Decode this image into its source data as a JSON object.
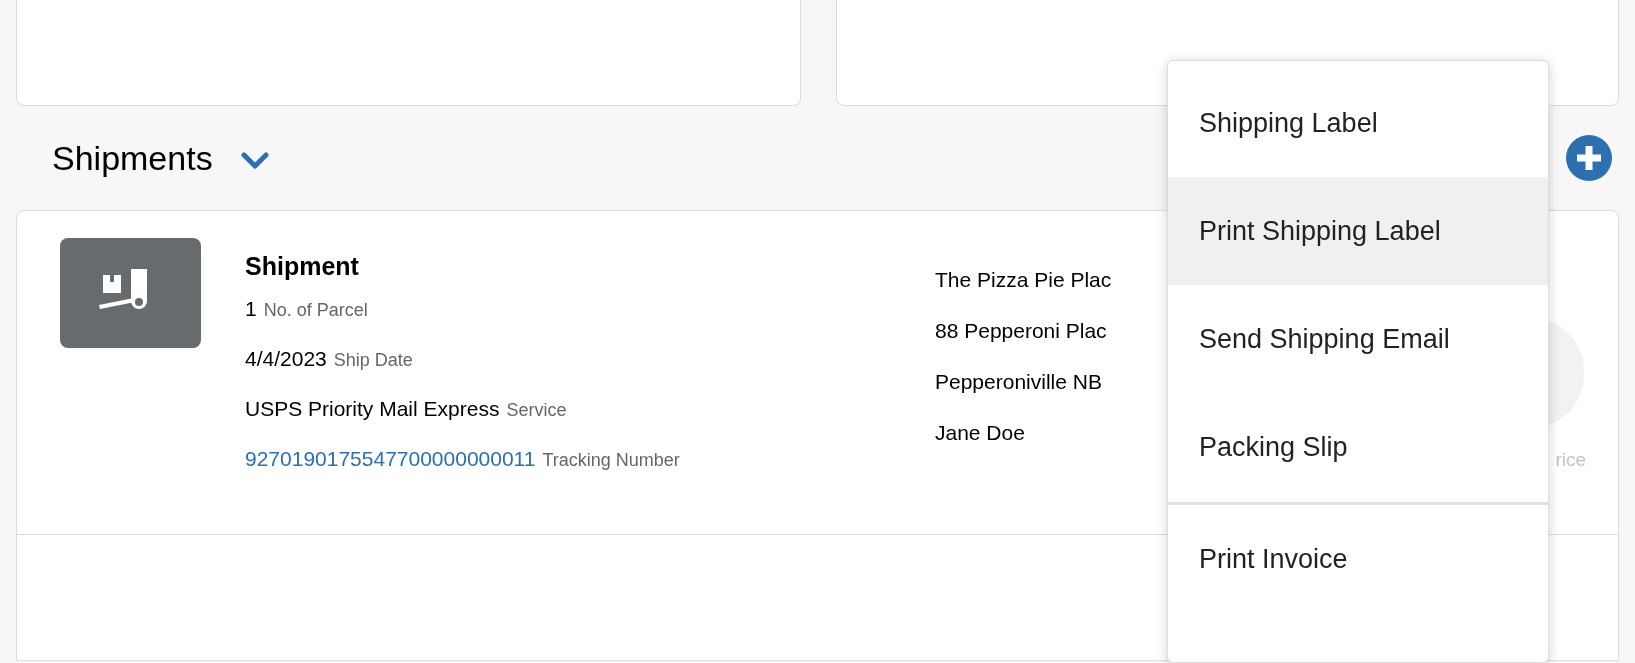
{
  "section": {
    "title": "Shipments"
  },
  "shipment": {
    "title": "Shipment",
    "fields": [
      {
        "value": "1",
        "label": "No. of Parcel",
        "kind": "text"
      },
      {
        "value": "4/4/2023",
        "label": "Ship Date",
        "kind": "text"
      },
      {
        "value": "USPS Priority Mail Express",
        "label": "Service",
        "kind": "text"
      },
      {
        "value": "9270190175547700000000011",
        "label": "Tracking Number",
        "kind": "link"
      }
    ],
    "address": [
      "The Pizza Pie Plac",
      "88 Pepperoni Plac",
      "Pepperoniville NB",
      "Jane Doe"
    ],
    "hidden_label": "rice"
  },
  "menu": {
    "items": [
      {
        "label": "Shipping Label",
        "selected": false,
        "divider_before": false
      },
      {
        "label": "Print Shipping Label",
        "selected": true,
        "divider_before": false
      },
      {
        "label": "Send Shipping Email",
        "selected": false,
        "divider_before": false
      },
      {
        "label": "Packing Slip",
        "selected": false,
        "divider_before": false
      },
      {
        "label": "Print Invoice",
        "selected": false,
        "divider_before": true
      }
    ]
  }
}
